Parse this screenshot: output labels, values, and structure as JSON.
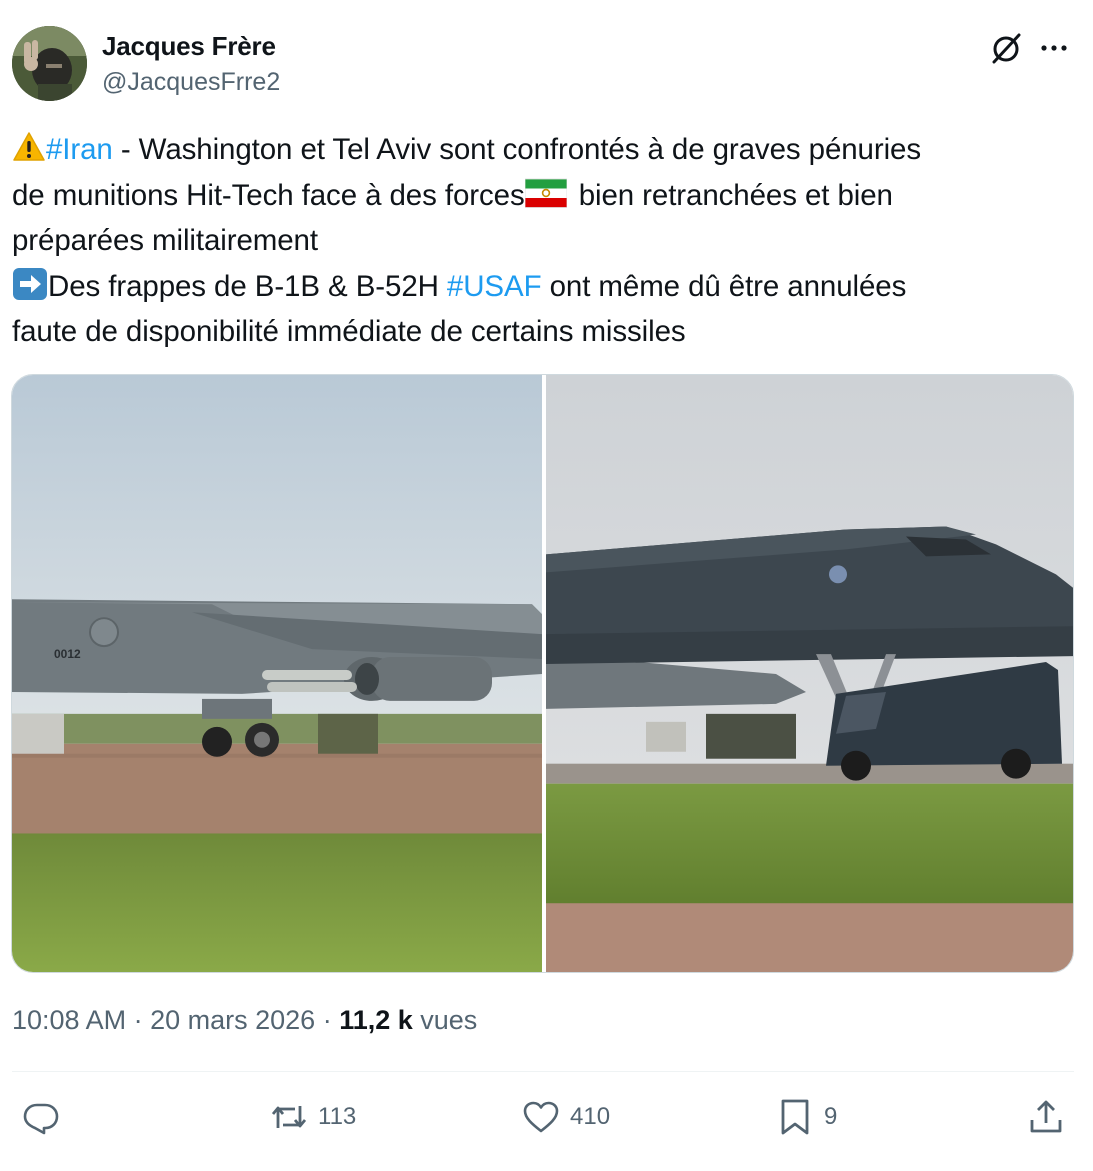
{
  "author": {
    "name": "Jacques Frère",
    "handle": "@JacquesFrre2"
  },
  "tweet": {
    "lines": [
      {
        "hashtag": "#Iran",
        "text": " - Washington et Tel Aviv sont confrontés à de graves pénuries"
      },
      {
        "text_before_flag": "de munitions Hit-Tech face à des forces",
        "text_after_flag": " bien retranchées et bien"
      },
      {
        "text": "préparées militairement"
      },
      {
        "text_before": "Des frappes de B-1B & B-52H ",
        "hashtag": "#USAF",
        "text_after": " ont même dû être annulées"
      },
      {
        "text": "faute de disponibilité immédiate de certains missiles"
      }
    ],
    "emojis": [
      "warning-emoji",
      "iran-flag-emoji",
      "right-arrow-emoji"
    ]
  },
  "media": {
    "left_photo": {
      "subject": "B-52H bomber on tarmac",
      "tail_text": "0012"
    },
    "right_photo": {
      "subject": "B-1B bomber with van on tarmac"
    }
  },
  "meta": {
    "time": "10:08 AM",
    "separator": " · ",
    "date": "20 mars 2026",
    "views_count": "11,2 k",
    "views_label": " vues"
  },
  "actions": {
    "reply_count": "",
    "retweet_count": "113",
    "like_count": "410",
    "bookmark_count": "9"
  },
  "colors": {
    "link": "#1d9bf0",
    "secondary_text": "#536471",
    "primary_text": "#0f1419",
    "border": "#cfd9de"
  },
  "icons": [
    "grok-icon",
    "more-icon",
    "reply-icon",
    "retweet-icon",
    "like-icon",
    "bookmark-icon",
    "share-icon"
  ]
}
